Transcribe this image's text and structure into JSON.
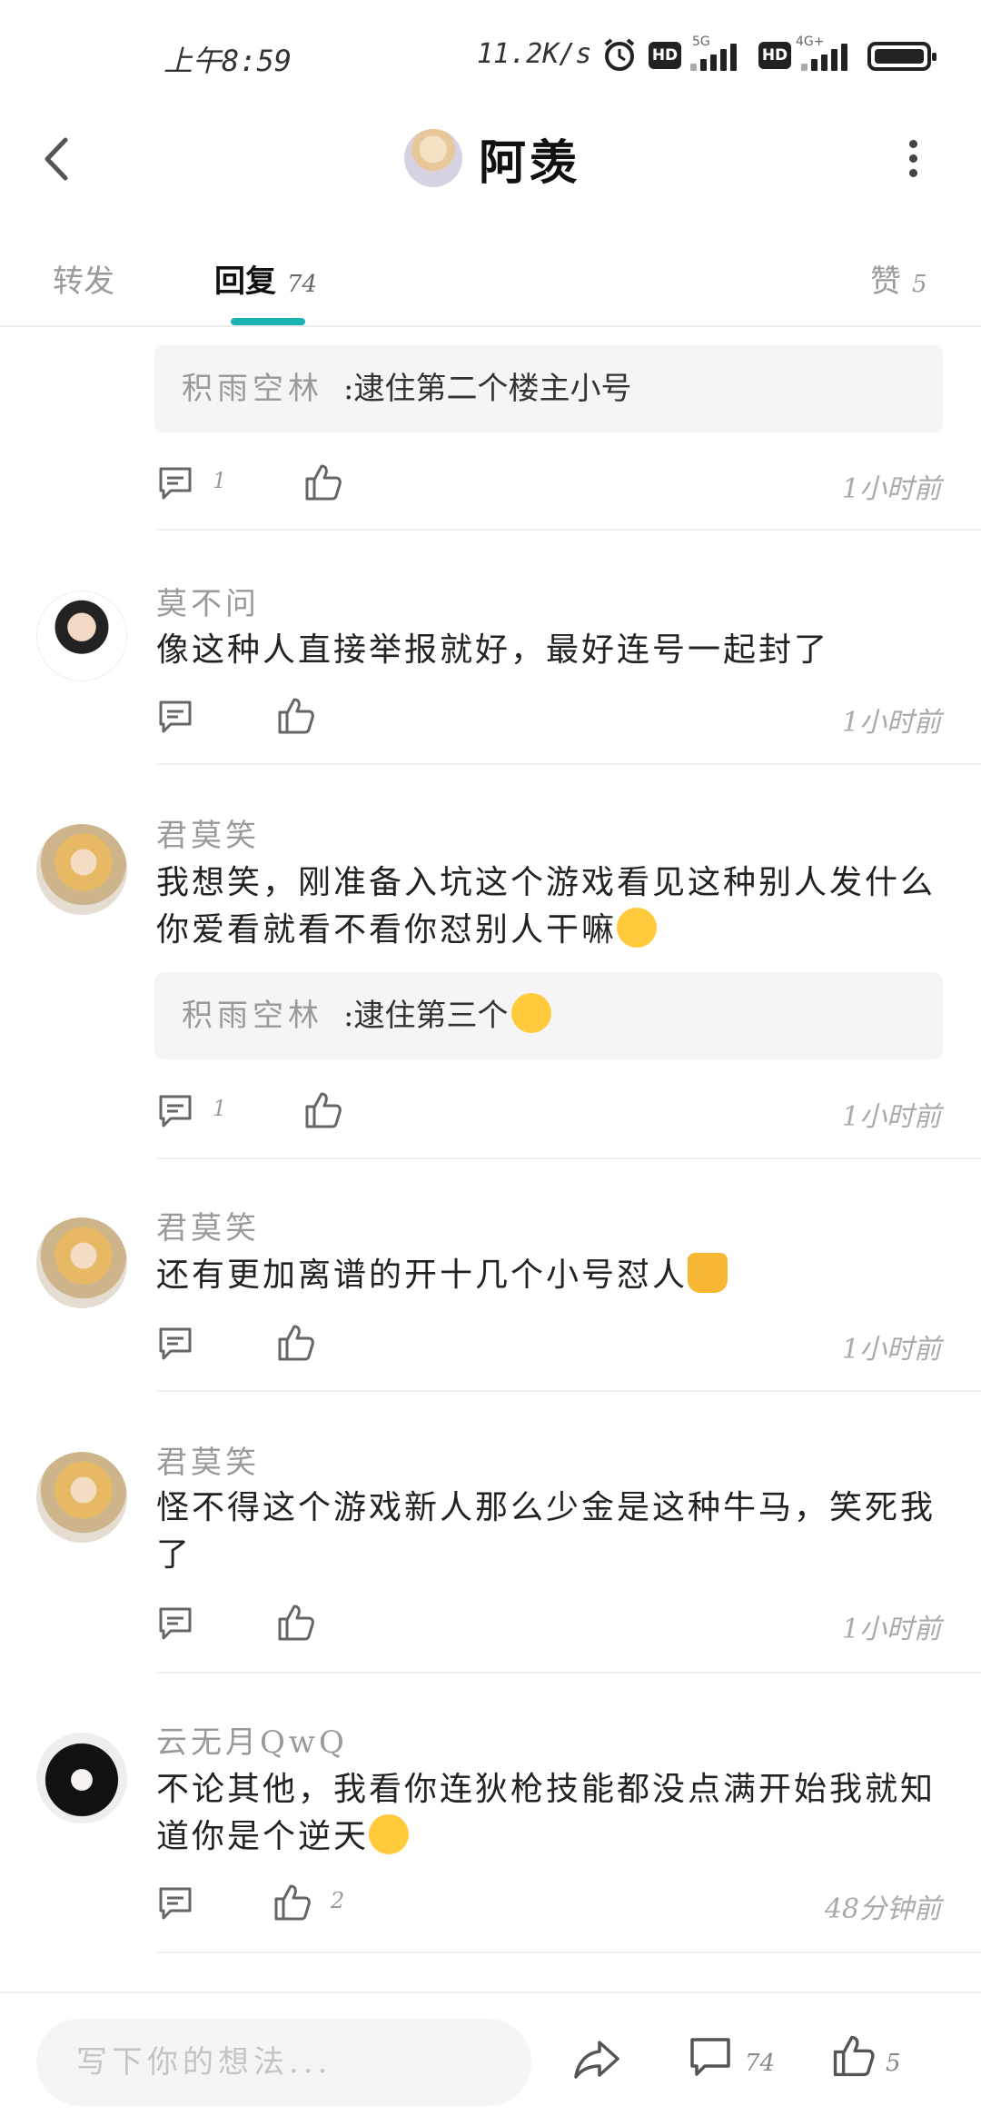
{
  "status": {
    "time": "上午8:59",
    "network_speed": "11.2K/s",
    "sim1_label": "5G",
    "sim2_label": "4G+",
    "hd1": "HD",
    "hd2": "HD"
  },
  "header": {
    "title": "阿羡"
  },
  "tabs": [
    {
      "label": "转发",
      "count": ""
    },
    {
      "label": "回复",
      "count": "74"
    },
    {
      "label": "赞",
      "count": "5"
    }
  ],
  "comments": [
    {
      "quote_name": "积雨空林",
      "quote_text": ":逮住第二个楼主小号",
      "reply_count": "1",
      "like_count": "",
      "time": "1小时前"
    },
    {
      "name": "莫不问",
      "text": "像这种人直接举报就好，最好连号一起封了",
      "reply_count": "",
      "like_count": "",
      "time": "1小时前"
    },
    {
      "name": "君莫笑",
      "text": "我想笑，刚准备入坑这个游戏看见这种别人发什么你爱看就看不看你怼别人干嘛",
      "quote_name": "积雨空林",
      "quote_text": ":逮住第三个",
      "reply_count": "1",
      "like_count": "",
      "time": "1小时前"
    },
    {
      "name": "君莫笑",
      "text": "还有更加离谱的开十几个小号怼人",
      "reply_count": "",
      "like_count": "",
      "time": "1小时前"
    },
    {
      "name": "君莫笑",
      "text": "怪不得这个游戏新人那么少金是这种牛马，笑死我了",
      "reply_count": "",
      "like_count": "",
      "time": "1小时前"
    },
    {
      "name": "云无月QwQ",
      "text": "不论其他，我看你连狄枪技能都没点满开始我就知道你是个逆天",
      "reply_count": "",
      "like_count": "2",
      "time": "48分钟前"
    }
  ],
  "bottom_bar": {
    "placeholder": "写下你的想法...",
    "comment_count": "74",
    "like_count": "5"
  },
  "icons": {
    "accent": "#1ab3b3"
  }
}
